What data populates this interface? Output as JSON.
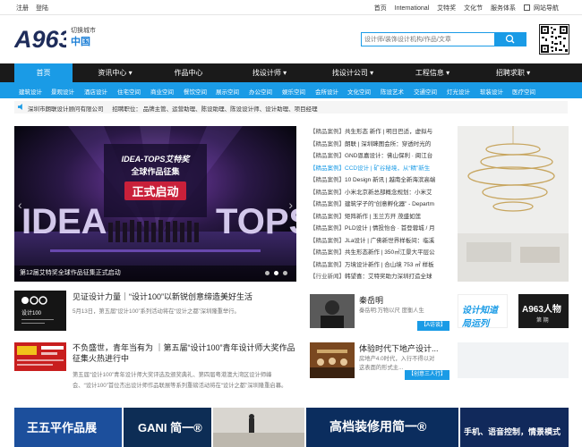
{
  "topbar": {
    "register": "注册",
    "login": "登陆",
    "links": [
      "首页",
      "International",
      "艾特奖",
      "文化节",
      "服务体系"
    ],
    "site_nav": "网站导航"
  },
  "header": {
    "logo_text": "A963",
    "switch_city": "切换城市",
    "city": "中国",
    "search_placeholder": "设计师/装饰设计机构/作品/文章"
  },
  "nav": [
    {
      "label": "首页",
      "active": true
    },
    {
      "label": "资讯中心 ▾"
    },
    {
      "label": "作品中心"
    },
    {
      "label": "找设计师 ▾"
    },
    {
      "label": "找设计公司 ▾"
    },
    {
      "label": "工程信息 ▾"
    },
    {
      "label": "招聘求职 ▾"
    }
  ],
  "subnav": [
    "建筑设计",
    "景观设计",
    "酒店设计",
    "住宅空间",
    "商业空间",
    "餐饮空间",
    "展示空间",
    "办公空间",
    "娱乐空间",
    "会所设计",
    "文化空间",
    "陈设艺术",
    "交通空间",
    "灯光设计",
    "软装设计",
    "医疗空间"
  ],
  "notice": {
    "company": "深圳市朗联设计顾问有限公司",
    "jobs": "招聘职位：  品牌主管、运营助理、陈设助理、陈设设计师、设计助理、项目经理"
  },
  "banner": {
    "poster_line1": "IDEA-TOPS艾特奖",
    "poster_line2": "全球作品征集",
    "poster_line3": "正式启动",
    "caption": "第12届艾特奖全球作品征集正式启动"
  },
  "cases": [
    {
      "tag": "【精品案例】",
      "text": "共生形态 新作 | 明日巴适，虚拟与"
    },
    {
      "tag": "【精品案例】",
      "text": "朗联 | 深圳睐图会所：穿透时光的"
    },
    {
      "tag": "【精品案例】",
      "text": "GND恩嘉设计：佛山保利 · 阆江台"
    },
    {
      "tag": "【精品案例】",
      "text": "CCD设计 | 矿谷秘境，从“精”新生",
      "hl": true
    },
    {
      "tag": "【精品案例】",
      "text": "10 Design 新讯 | 越南全新海滨高端"
    },
    {
      "tag": "【精品案例】",
      "text": "小米北京新总部概念规划：小米艾"
    },
    {
      "tag": "【精品案例】",
      "text": "建筑学子的“创意孵化器” - Departm"
    },
    {
      "tag": "【精品案例】",
      "text": "矩阵新作 | 玉兰方开 茂盛如莲"
    },
    {
      "tag": "【精品案例】",
      "text": "PLD设计 | 情投怡合 · 首登蓉城 / 月"
    },
    {
      "tag": "【精品案例】",
      "text": "JLa设计 | 广佛新世界样板间：临溪"
    },
    {
      "tag": "【精品案例】",
      "text": "共生形态新作 | 350㎡江景大平层公"
    },
    {
      "tag": "【精品案例】",
      "text": "万境设计新作 | 合山境 753 ㎡ 样板"
    },
    {
      "tag": "【行业新闻】",
      "text": "韩望喜：艾特奖助力深圳打造全球"
    }
  ],
  "news": [
    {
      "title": "见证设计力量｜“设计100”以新锐创意缔造美好生活",
      "desc": "5月13日，第五届“设计100”系列活动将在“设计之都”深圳隆重举行。",
      "thumb_text": "设计100"
    },
    {
      "title": "不负盛世，青年当有为 ｜第五届“设计100”青年设计师大奖作品征集火热进行中",
      "desc1": "第五届“设计100”青年设计师大奖评选及颁奖典礼、第四届粤港澳大湾区设计师峰",
      "desc2": "会、“设计100”首位杰出设计师作品联展等系列重磅活动将在“设计之都”深圳隆重启幕。"
    }
  ],
  "person": {
    "name": "秦岳明",
    "desc": "秦岳明:万物以尺 度衡人生",
    "badge": "【A访谈】"
  },
  "profile_imgs": {
    "left_text": "设计知道 局运列",
    "right_text1": "A963人物",
    "right_text2": "第 期"
  },
  "experience": {
    "title": "体验时代下地产设计...",
    "desc1": "房地产4.0时代，入行不得以对",
    "desc2": "这表面的形式主...",
    "badge": "【创意三人行】"
  },
  "ads": [
    {
      "text": "王五平作品展",
      "bg": "#1c4f9c"
    },
    {
      "text": "GANI 简一®",
      "bg": "#0d2d55"
    },
    {
      "text": "",
      "bg": "#d9d6d0"
    },
    {
      "text": "高档装修用简一®",
      "bg": "#0b2d5e"
    },
    {
      "text": "手机、语音控制，情景模式",
      "bg": "#11295b"
    }
  ],
  "colors": {
    "accent": "#1a9be6",
    "nav_bg": "#1a1a1a"
  }
}
